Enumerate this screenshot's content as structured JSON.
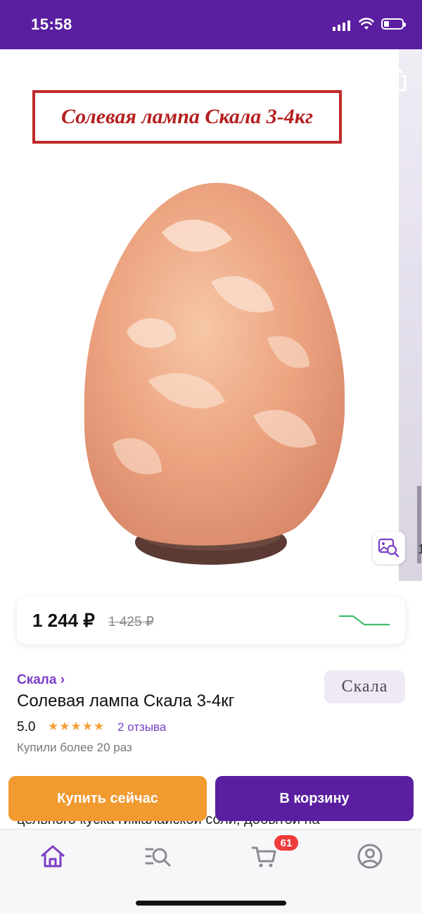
{
  "status": {
    "time": "15:58"
  },
  "gallery": {
    "banner": "Солевая лампа Скала 3-4кг",
    "next_slide_label": "1"
  },
  "price": {
    "current": "1 244 ₽",
    "old": "1 425 ₽"
  },
  "product": {
    "brand_link": "Скала ›",
    "brand_logo": "Скала",
    "title": "Солевая лампа Скала 3-4кг",
    "rating": "5.0",
    "stars": "★★★★★",
    "reviews": "2 отзыва",
    "bought": "Купили более 20 раз",
    "description_partial": "цельного куска гималайской соли, добытой на"
  },
  "actions": {
    "buy_now": "Купить сейчас",
    "add_to_cart": "В корзину"
  },
  "tabbar": {
    "items": [
      {
        "icon": "home-icon"
      },
      {
        "icon": "catalog-search-icon"
      },
      {
        "icon": "cart-icon"
      },
      {
        "icon": "profile-icon"
      }
    ],
    "cart_badge": "61"
  },
  "colors": {
    "brand_purple": "#5a1fa0",
    "accent_orange": "#f19a2f",
    "link_purple": "#7a3fc7",
    "badge_red": "#ef3b3b"
  }
}
